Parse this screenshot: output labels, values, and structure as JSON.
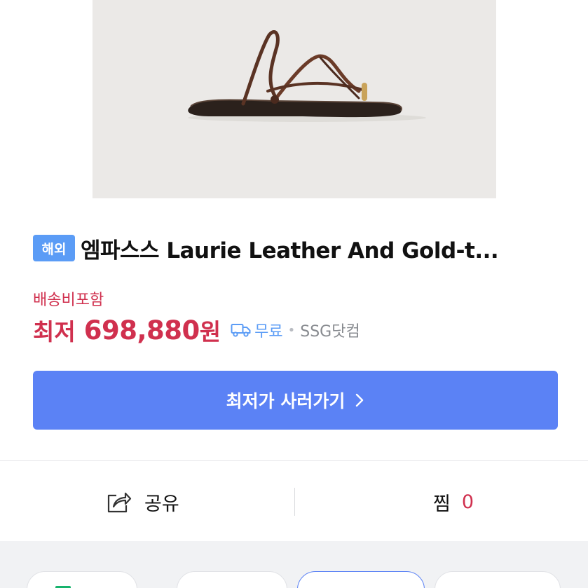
{
  "product": {
    "badge": "해외",
    "title": "엠파스스 Laurie Leather And Gold-t...",
    "image_icon": "zoom-expand-icon"
  },
  "pricing": {
    "shipping_note": "배송비포함",
    "prefix": "최저",
    "price": "698,880",
    "unit": "원",
    "shipping_free": "무료",
    "seller": "SSG닷컴"
  },
  "cta": {
    "label": "최저가 사러가기",
    "chevron": "›"
  },
  "actions": {
    "share_label": "공유",
    "wish_label": "찜",
    "wish_count": "0"
  },
  "colors": {
    "accent_red": "#d0304e",
    "accent_blue": "#5b82f5",
    "badge_blue": "#5b9cf6"
  }
}
